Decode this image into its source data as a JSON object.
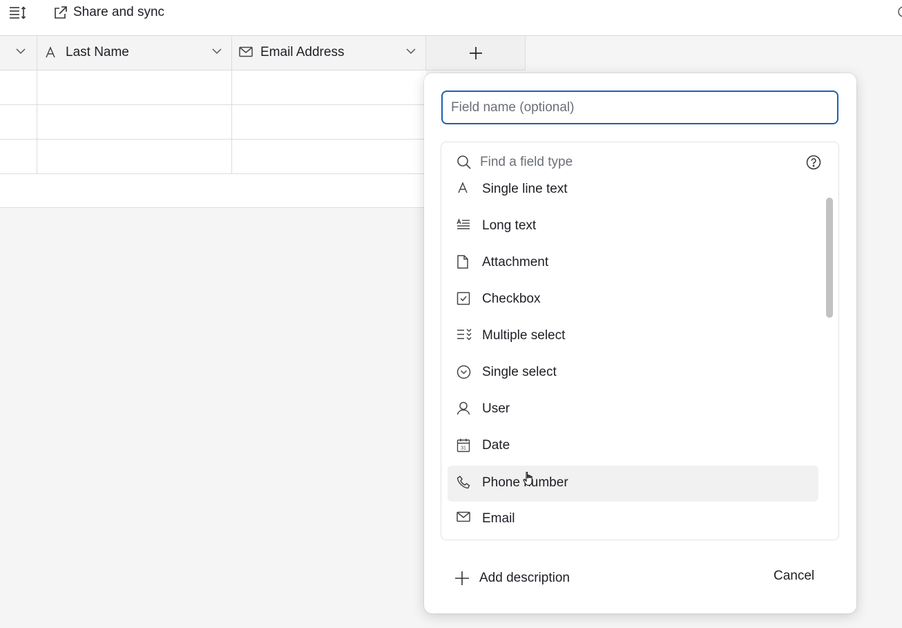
{
  "toolbar": {
    "rows_icon": "row-height-icon",
    "share_icon": "external-link-icon",
    "share_label": "Share and sync"
  },
  "grid": {
    "columns": [
      {
        "label": "",
        "icon": "chevron-down-icon"
      },
      {
        "label": "Last Name",
        "icon": "single-line-text-icon"
      },
      {
        "label": "Email Address",
        "icon": "email-icon"
      }
    ],
    "add_column_icon": "plus-icon",
    "row_count": 3
  },
  "popup": {
    "field_name_placeholder": "Field name (optional)",
    "search_placeholder": "Find a field type",
    "help_icon": "help-icon",
    "field_types": [
      {
        "label": "Single line text",
        "icon": "single-line-text-icon"
      },
      {
        "label": "Long text",
        "icon": "long-text-icon"
      },
      {
        "label": "Attachment",
        "icon": "attachment-icon"
      },
      {
        "label": "Checkbox",
        "icon": "checkbox-icon"
      },
      {
        "label": "Multiple select",
        "icon": "multiple-select-icon"
      },
      {
        "label": "Single select",
        "icon": "single-select-icon"
      },
      {
        "label": "User",
        "icon": "user-icon"
      },
      {
        "label": "Date",
        "icon": "calendar-icon"
      },
      {
        "label": "Phone number",
        "icon": "phone-icon"
      },
      {
        "label": "Email",
        "icon": "email-icon"
      }
    ],
    "hovered_type": "Phone number",
    "add_description_label": "Add description",
    "cancel_label": "Cancel"
  }
}
